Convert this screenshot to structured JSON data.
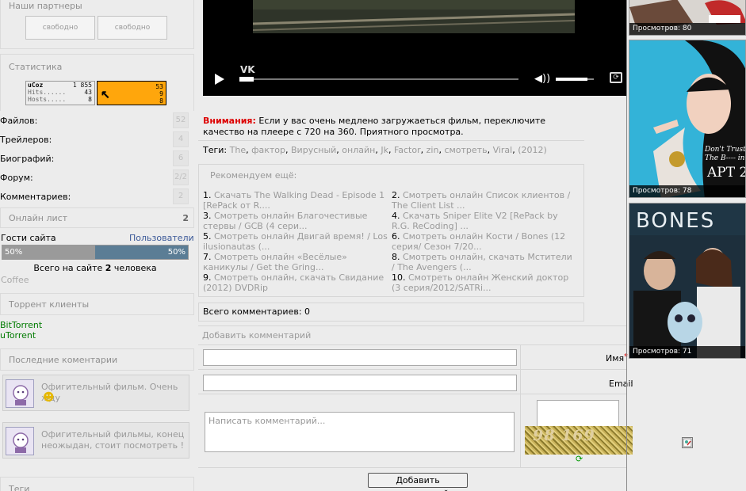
{
  "partners": {
    "title": "Наши партнеры",
    "slots": [
      "свободно",
      "свободно"
    ]
  },
  "stats": {
    "title": "Статистика",
    "ucoz_counter": {
      "logo": "uCoz",
      "rows": [
        {
          "label": "",
          "value": "1 855"
        },
        {
          "label": "Hits",
          "value": "43"
        },
        {
          "label": "Hosts",
          "value": "8"
        }
      ]
    },
    "ya_counter": {
      "values": [
        "53",
        "9",
        "8"
      ]
    },
    "rows": [
      {
        "label": "Файлов:",
        "value": "52"
      },
      {
        "label": "Трейлеров:",
        "value": "4"
      },
      {
        "label": "Биографий:",
        "value": "6"
      },
      {
        "label": "Форум:",
        "value": "2/2"
      },
      {
        "label": "Комментариев:",
        "value": "2"
      }
    ]
  },
  "online": {
    "title": "Онлайн лист",
    "count": "2",
    "guests_label": "Гости сайта",
    "users_label": "Пользователи",
    "guests_pct_text": "50%",
    "users_pct_text": "50%",
    "guests_fraction": 0.5,
    "total_prefix": "Всего на сайте ",
    "total_count": "2",
    "total_suffix": " человека",
    "user_name": "Coffee"
  },
  "torrents": {
    "title": "Торрент клиенты",
    "links": [
      "BitTorrent",
      "uTorrent"
    ]
  },
  "recent_comments": {
    "title": "Последние коментарии",
    "items": [
      {
        "text": "Офигительный фильм. Очень жду",
        "emoji": "smiley"
      },
      {
        "text": "Офигительный фильмы, конец неожыдан, стоит посмотреть !",
        "emoji": ""
      }
    ]
  },
  "tags_block_title": "Теги",
  "player": {
    "brand": "VK",
    "seek_fraction": 0.05,
    "volume_fraction": 0.83
  },
  "notice": {
    "warn": "Внимания:",
    "text": " Если у вас очень медлено загружаеться фильм, переключите качество на плеере с 720 на 360. Приятного просмотра."
  },
  "tags": {
    "label": "Теги:",
    "items": [
      "The",
      "фактор",
      "Вирусный",
      "онлайн",
      "Jk",
      "Factor",
      "zin",
      "смотреть",
      "Viral",
      "(2012)"
    ]
  },
  "recommended": {
    "title": "Рекомендуем ещё:",
    "items": [
      {
        "num": "1.",
        "text": " Скачать The Walking Dead - Episode 1 [RePack от R...."
      },
      {
        "num": "2.",
        "text": " Смотреть онлайн Список клиентов / The Client List ..."
      },
      {
        "num": "3.",
        "text": " Смотреть онлайн Благочестивые стервы / GCB (4 сери..."
      },
      {
        "num": "4.",
        "text": " Скачать Sniper Elite V2 [RePack by R.G. ReCoding] ..."
      },
      {
        "num": "5.",
        "text": " Смотреть онлайн Двигай время! / Los ilusionautas (..."
      },
      {
        "num": "6.",
        "text": " Смотреть онлайн Кости / Bones (12 серия/ Сезон 7/20..."
      },
      {
        "num": "7.",
        "text": " Смотреть онлайн «Весёлые» каникулы / Get the Gring..."
      },
      {
        "num": "8.",
        "text": " Смотреть онлайн, скачать Мстители / The Avengers (..."
      },
      {
        "num": "9.",
        "text": " Смотреть онлайн, скачать Свидание (2012) DVDRip"
      },
      {
        "num": "10.",
        "text": " Смотреть онлайн Женский доктор (3 серия/2012/SATRi..."
      }
    ]
  },
  "comments_total": "Всего комментариев: 0",
  "add_comment": {
    "title": "Добавить комментарий",
    "name_label": "Имя",
    "email_label": "Email",
    "textarea_placeholder": "Написать комментарий...",
    "captcha_text": "98 169",
    "submit": "Добавить комментарий"
  },
  "posters": [
    {
      "views": "Просмотров: 80",
      "title": ""
    },
    {
      "views": "Просмотров: 78",
      "title": "APT 23",
      "tagline": "Don't Trust The B---- in"
    },
    {
      "views": "Просмотров: 71",
      "title": "BONES"
    }
  ]
}
